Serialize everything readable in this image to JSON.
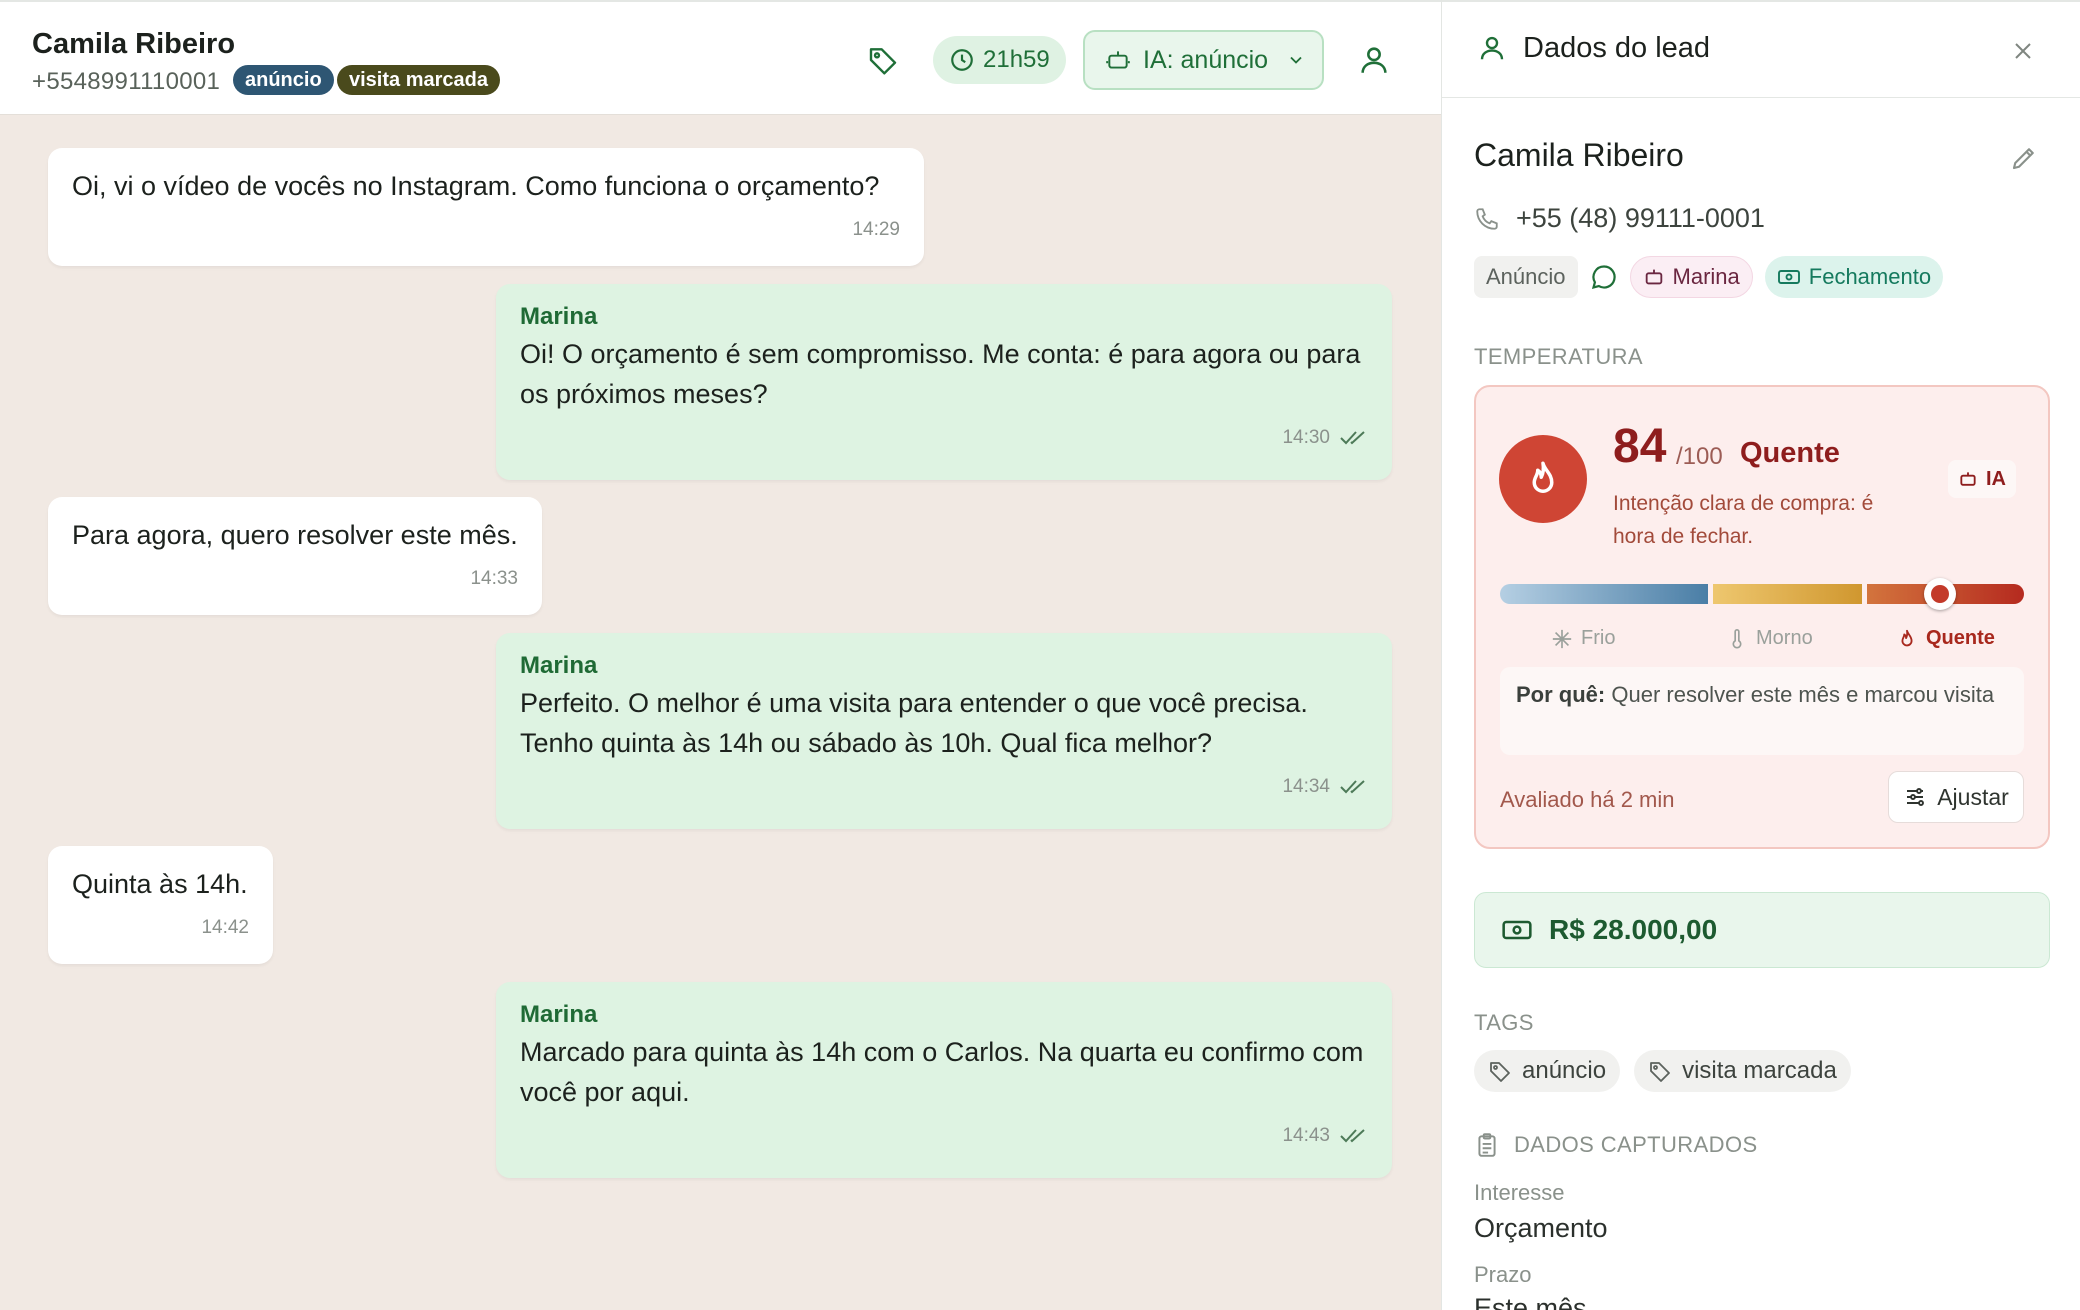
{
  "header": {
    "contact_name": "Camila Ribeiro",
    "contact_phone": "+5548991110001",
    "badges": [
      "anúncio",
      "visita marcada"
    ],
    "timer": "21h59",
    "ia_mode": "IA: anúncio"
  },
  "messages": [
    {
      "direction": "in",
      "text": "Oi, vi o vídeo de vocês no Instagram. Como funciona o orçamento?",
      "time": "14:29"
    },
    {
      "direction": "out",
      "sender": "Marina",
      "text": "Oi! O orçamento é sem compromisso. Me conta: é para agora ou para os próximos meses?",
      "time": "14:30"
    },
    {
      "direction": "in",
      "text": "Para agora, quero resolver este mês.",
      "time": "14:33"
    },
    {
      "direction": "out",
      "sender": "Marina",
      "text": "Perfeito. O melhor é uma visita para entender o que você precisa. Tenho quinta às 14h ou sábado às 10h. Qual fica melhor?",
      "time": "14:34"
    },
    {
      "direction": "in",
      "text": "Quinta às 14h.",
      "time": "14:42"
    },
    {
      "direction": "out",
      "sender": "Marina",
      "text": "Marcado para quinta às 14h com o Carlos. Na quarta eu confirmo com você por aqui.",
      "time": "14:43"
    }
  ],
  "panel": {
    "title": "Dados do lead",
    "lead_name": "Camila Ribeiro",
    "phone": "+55 (48) 99111-0001",
    "source": "Anúncio",
    "agent": "Marina",
    "stage": "Fechamento",
    "temperature": {
      "section_label": "TEMPERATURA",
      "score": "84",
      "max": "/100",
      "label": "Quente",
      "description": "Intenção clara de compra: é hora de fechar.",
      "ia_tag": "IA",
      "level": 0.84,
      "legend": [
        "Frio",
        "Morno",
        "Quente"
      ],
      "why_label": "Por quê:",
      "why_text": "Quer resolver este mês e marcou visita",
      "evaluated": "Avaliado há 2 min",
      "adjust": "Ajustar"
    },
    "value": "R$ 28.000,00",
    "tags_label": "TAGS",
    "tags": [
      "anúncio",
      "visita marcada"
    ],
    "captured_label": "DADOS CAPTURADOS",
    "fields": [
      {
        "label": "Interesse",
        "value": "Orçamento"
      },
      {
        "label": "Prazo",
        "value": "Este mês"
      }
    ]
  },
  "colors": {
    "accent_green": "#1f6f38",
    "hot_red": "#cf4534",
    "badge_blue": "#2e5673",
    "badge_olive": "#4a4a1c"
  },
  "icons": [
    "tag-icon",
    "clock-icon",
    "robot-icon",
    "chevron-down-icon",
    "user-icon",
    "close-icon",
    "pencil-icon",
    "phone-icon",
    "chat-bubble-icon",
    "banknote-icon",
    "flame-icon",
    "snowflake-icon",
    "thermometer-icon",
    "sliders-icon",
    "double-check-icon",
    "clipboard-icon"
  ]
}
